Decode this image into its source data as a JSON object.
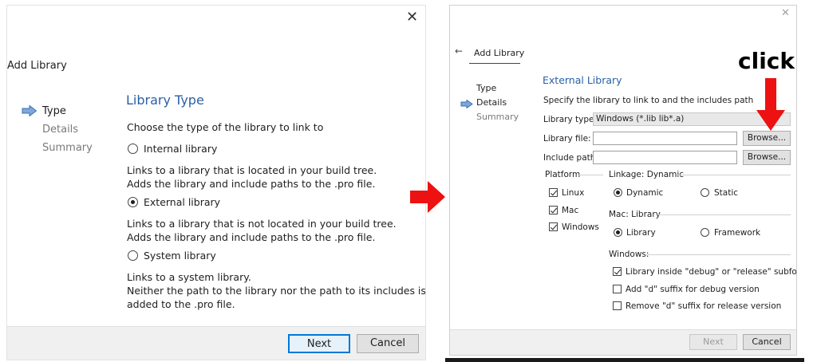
{
  "left_dialog": {
    "title": "Add Library",
    "close_glyph": "✕",
    "steps": [
      {
        "label": "Type",
        "current": true
      },
      {
        "label": "Details",
        "current": false
      },
      {
        "label": "Summary",
        "current": false
      }
    ],
    "heading": "Library Type",
    "prompt": "Choose the type of the library to link to",
    "options": [
      {
        "label": "Internal library",
        "selected": false,
        "desc": [
          "Links to a library that is located in your build tree.",
          "Adds the library and include paths to the .pro file."
        ]
      },
      {
        "label": "External library",
        "selected": true,
        "desc": [
          "Links to a library that is not located in your build tree.",
          "Adds the library and include paths to the .pro file."
        ]
      },
      {
        "label": "System library",
        "selected": false,
        "desc": [
          "Links to a system library.",
          "Neither the path to the library nor the path to its includes is",
          "added to the .pro file."
        ]
      }
    ],
    "next_label": "Next",
    "cancel_label": "Cancel"
  },
  "right_dialog": {
    "close_glyph": "✕",
    "back_glyph": "←",
    "title": "Add Library",
    "steps": [
      {
        "label": "Type",
        "current": false
      },
      {
        "label": "Details",
        "current": true
      },
      {
        "label": "Summary",
        "current": false
      }
    ],
    "heading": "External Library",
    "prompt": "Specify the library to link to and the includes path",
    "library_type_label": "Library type:",
    "library_type_value": "Windows (*.lib lib*.a)",
    "library_file_label": "Library file:",
    "library_file_value": "",
    "include_path_label": "Include path:",
    "include_path_value": "",
    "browse_label": "Browse...",
    "platform_label": "Platform",
    "platforms": [
      {
        "label": "Linux",
        "checked": true
      },
      {
        "label": "Mac",
        "checked": true
      },
      {
        "label": "Windows",
        "checked": true
      }
    ],
    "linkage_label": "Linkage: Dynamic",
    "linkage_dynamic": "Dynamic",
    "linkage_static": "Static",
    "mac_label": "Mac: Library",
    "mac_library": "Library",
    "mac_framework": "Framework",
    "windows_label": "Windows:",
    "windows_options": [
      {
        "label": "Library inside \"debug\" or \"release\" subfolder",
        "checked": true
      },
      {
        "label": "Add \"d\" suffix for debug version",
        "checked": false
      },
      {
        "label": "Remove \"d\" suffix for release version",
        "checked": false
      }
    ],
    "next_label": "Next",
    "cancel_label": "Cancel"
  },
  "annotation": {
    "click_text": "click",
    "color": "#ee1111"
  }
}
